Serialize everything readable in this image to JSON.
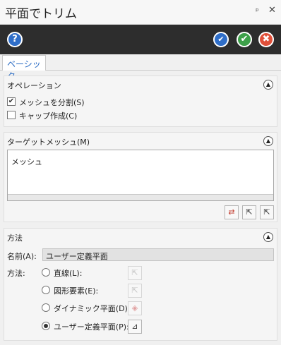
{
  "window": {
    "title": "平面でトリム",
    "pin_glyph": "ᵖ",
    "close_glyph": "✕"
  },
  "toolbar": {
    "help_glyph": "?",
    "apply_glyph": "✔",
    "ok_glyph": "✔",
    "cancel_glyph": "✖"
  },
  "tabs": [
    {
      "label": "ベーシック"
    }
  ],
  "operation": {
    "title": "オペレーション",
    "split_mesh": {
      "label": "メッシュを分割(S)",
      "checked": true,
      "mark": "✔"
    },
    "cap": {
      "label": "キャップ作成(C)",
      "checked": false
    }
  },
  "target_mesh": {
    "title": "ターゲットメッシュ(M)",
    "items": [
      "メッシュ"
    ],
    "buttons": [
      {
        "icon": "swap-arrows-icon",
        "glyph": "⇄"
      },
      {
        "icon": "add-select-icon",
        "glyph": "⇱"
      },
      {
        "icon": "select-icon",
        "glyph": "⇱"
      }
    ]
  },
  "method": {
    "title": "方法",
    "name_label": "名前(A):",
    "name_value": "ユーザー定義平面",
    "method_label": "方法:",
    "options": [
      {
        "label": "直線(L):",
        "selected": false,
        "icon": "pointer-icon",
        "glyph": "⇱",
        "enabled": false
      },
      {
        "label": "図形要素(E):",
        "selected": false,
        "icon": "pointer-icon",
        "glyph": "⇱",
        "enabled": false
      },
      {
        "label": "ダイナミック平面(D):",
        "selected": false,
        "icon": "dynamic-plane-icon",
        "glyph": "◈",
        "enabled": false
      },
      {
        "label": "ユーザー定義平面(P):",
        "selected": true,
        "icon": "user-plane-icon",
        "glyph": "⊿",
        "enabled": true
      }
    ]
  },
  "collapse_glyph": "▲",
  "colors": {
    "accent": "#2b6cc4",
    "ok": "#3ea04a",
    "cancel": "#e0503a",
    "toolbar_bg": "#2d2d2d"
  }
}
